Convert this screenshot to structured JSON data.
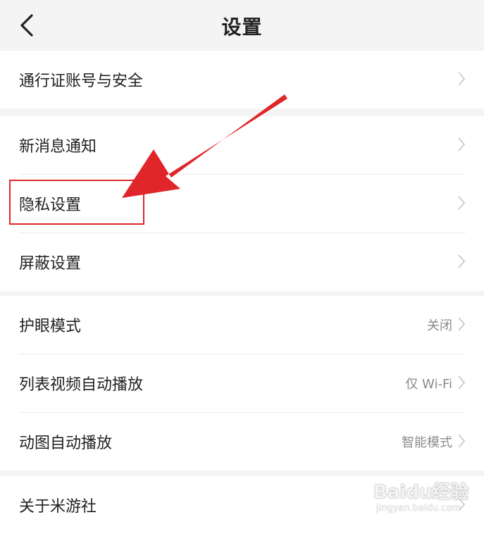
{
  "header": {
    "title": "设置",
    "back_icon": "chevron-left-icon"
  },
  "groups": [
    {
      "items": [
        {
          "label": "通行证账号与安全",
          "value": ""
        }
      ]
    },
    {
      "items": [
        {
          "label": "新消息通知",
          "value": ""
        },
        {
          "label": "隐私设置",
          "value": ""
        },
        {
          "label": "屏蔽设置",
          "value": ""
        }
      ]
    },
    {
      "items": [
        {
          "label": "护眼模式",
          "value": "关闭"
        },
        {
          "label": "列表视频自动播放",
          "value": "仅 Wi-Fi"
        },
        {
          "label": "动图自动播放",
          "value": "智能模式"
        }
      ]
    },
    {
      "items": [
        {
          "label": "关于米游社",
          "value": ""
        }
      ]
    }
  ],
  "annotation": {
    "highlighted_item": "隐私设置",
    "highlight_color": "#e0262b",
    "arrow_color": "#e0262b"
  },
  "watermark": {
    "brand": "Baidu经验",
    "url": "jingyan.baidu.com"
  },
  "colors": {
    "page_background": "#f4f4f4",
    "card_background": "#ffffff",
    "text_primary": "#222222",
    "text_secondary": "#8a8a8a",
    "chevron": "#c4c4c4"
  }
}
